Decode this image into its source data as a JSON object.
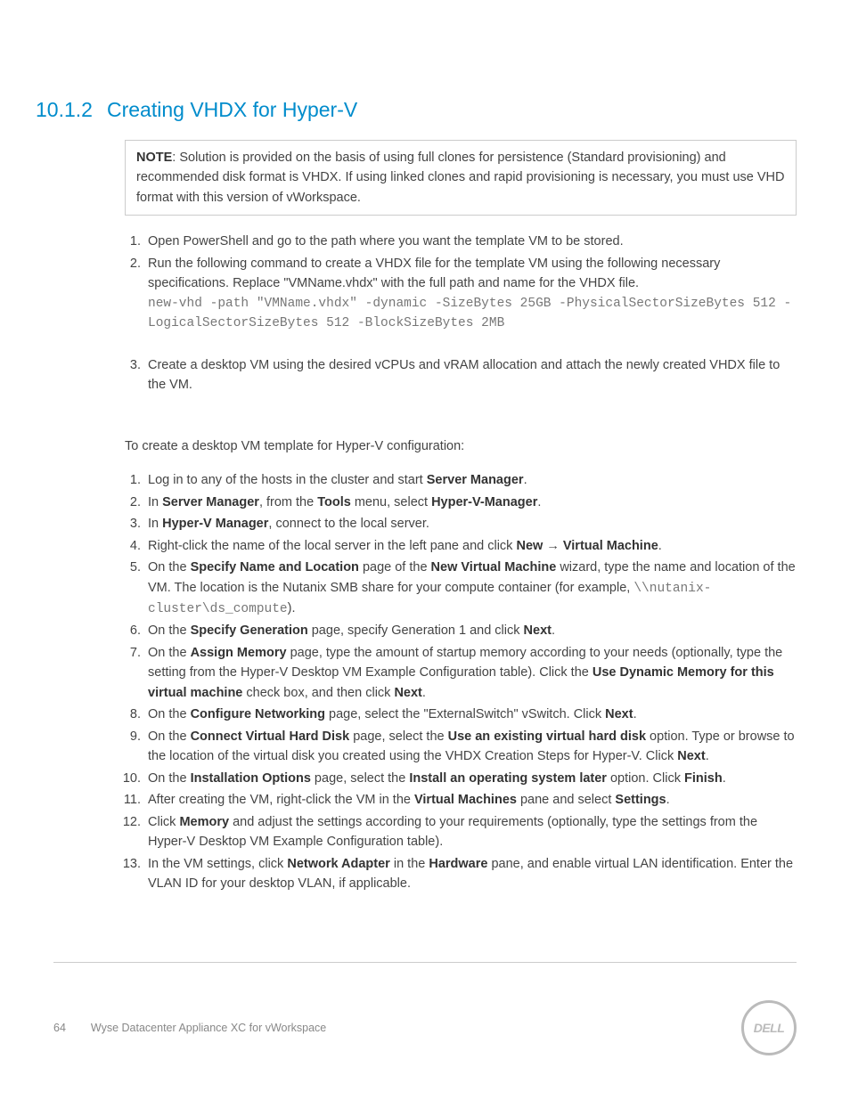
{
  "heading": {
    "number": "10.1.2",
    "title": "Creating VHDX for Hyper-V"
  },
  "note": {
    "label": "NOTE",
    "text": ": Solution is provided on the basis of using full clones for persistence (Standard provisioning) and recommended disk format is VHDX.  If using linked clones and rapid provisioning is necessary, you must use VHD format with this version of vWorkspace."
  },
  "list1": {
    "i1": "Open PowerShell and go to the path where you want the template VM to be stored.",
    "i2": "Run the following command to create a VHDX file for the template VM using the following necessary specifications.  Replace \"VMName.vhdx\" with the full path and name for the VHDX file.",
    "i2_code": "new-vhd -path \"VMName.vhdx\" -dynamic -SizeBytes 25GB -PhysicalSectorSizeBytes 512 -LogicalSectorSizeBytes 512 -BlockSizeBytes 2MB",
    "i3": "Create a desktop VM using the desired vCPUs and vRAM allocation and attach the newly created VHDX file to the VM."
  },
  "intro2": "To create a desktop VM template for Hyper-V configuration:",
  "list2": {
    "i1a": "Log in to any of the hosts in the cluster and start ",
    "i1b": "Server Manager",
    "i1c": ".",
    "i2a": "In ",
    "i2b": "Server Manager",
    "i2c": ", from the ",
    "i2d": "Tools",
    "i2e": " menu, select ",
    "i2f": "Hyper-V-Manager",
    "i2g": ".",
    "i3a": "In ",
    "i3b": "Hyper-V Manager",
    "i3c": ", connect to the local server.",
    "i4a": "Right-click the name of the local server in the left pane and click ",
    "i4b": "New",
    "i4arrow": " → ",
    "i4c": "Virtual Machine",
    "i4d": ".",
    "i5a": "On the ",
    "i5b": "Specify Name and Location",
    "i5c": " page of the ",
    "i5d": "New Virtual Machine",
    "i5e": " wizard, type the name and location of the VM. The location is the Nutanix SMB share for your compute container (for example, ",
    "i5code": "\\\\nutanix-cluster\\ds_compute",
    "i5f": ").",
    "i6a": "On the ",
    "i6b": "Specify Generation",
    "i6c": " page, specify Generation 1 and click ",
    "i6d": "Next",
    "i6e": ".",
    "i7a": "On the ",
    "i7b": "Assign Memory",
    "i7c": " page, type the amount of startup memory according to your needs (optionally, type the setting from the Hyper-V Desktop VM Example Configuration table).  Click the ",
    "i7d": "Use Dynamic Memory for this virtual machine",
    "i7e": " check box, and then click ",
    "i7f": "Next",
    "i7g": ".",
    "i8a": "On the ",
    "i8b": "Configure Networking",
    "i8c": " page, select the \"ExternalSwitch\" vSwitch.  Click ",
    "i8d": "Next",
    "i8e": ".",
    "i9a": "On the ",
    "i9b": "Connect Virtual Hard Disk",
    "i9c": " page, select the ",
    "i9d": "Use an existing virtual hard disk",
    "i9e": " option.  Type or browse to the location of the virtual disk you created using the VHDX Creation Steps for Hyper-V.  Click ",
    "i9f": "Next",
    "i9g": ".",
    "i10a": "On the ",
    "i10b": "Installation Options",
    "i10c": " page, select the ",
    "i10d": "Install an operating system later",
    "i10e": " option.  Click ",
    "i10f": "Finish",
    "i10g": ".",
    "i11a": "After creating the VM, right-click the VM in the ",
    "i11b": "Virtual Machines",
    "i11c": " pane and select ",
    "i11d": "Settings",
    "i11e": ".",
    "i12a": "Click ",
    "i12b": "Memory",
    "i12c": " and adjust the settings according to your requirements (optionally, type the settings from the Hyper-V Desktop VM Example Configuration table).",
    "i13a": "In the VM settings, click ",
    "i13b": "Network Adapter",
    "i13c": " in the ",
    "i13d": "Hardware",
    "i13e": " pane, and enable virtual LAN identification. Enter the VLAN ID for your desktop VLAN, if applicable."
  },
  "footer": {
    "pagenum": "64",
    "doctitle": "Wyse Datacenter Appliance XC for vWorkspace",
    "logo": "DELL"
  }
}
